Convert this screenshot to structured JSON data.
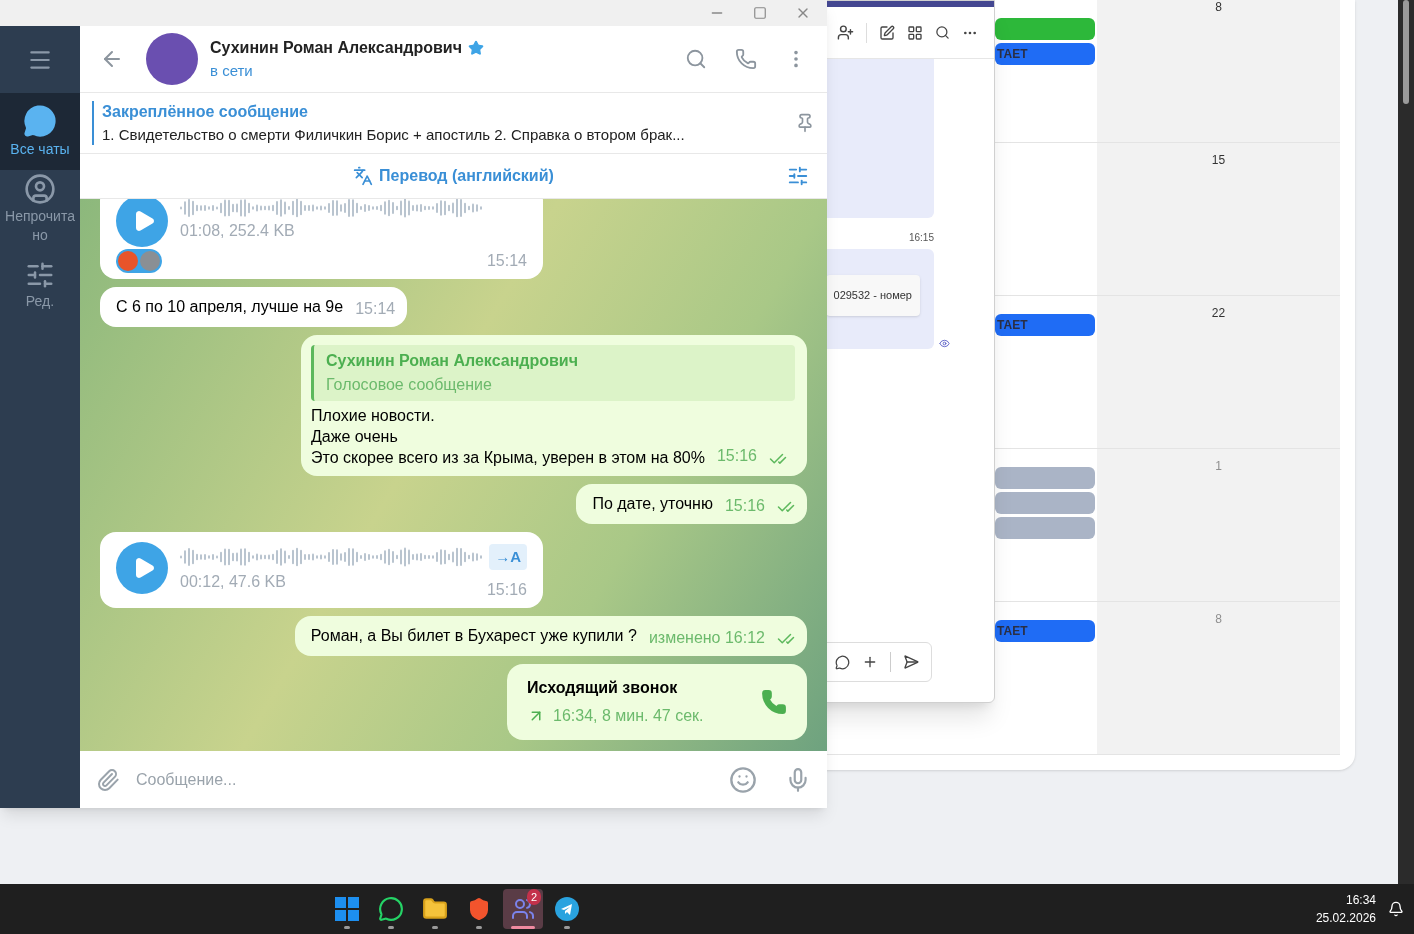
{
  "telegram": {
    "sidebar": {
      "items": [
        {
          "kind": "chats",
          "label": "Все чаты",
          "selected": true
        },
        {
          "kind": "unread",
          "label": "Непрочитано",
          "selected": false
        },
        {
          "kind": "edit",
          "label": "Ред.",
          "selected": false
        }
      ]
    },
    "header": {
      "name": "Сухинин Роман Александрович",
      "starred": true,
      "status": "в сети"
    },
    "pinned": {
      "title": "Закреплённое сообщение",
      "text": "1. Свидетельство о смерти Филичкин Борис + апостиль 2. Справка о втором брак..."
    },
    "translate_bar": {
      "label": "Перевод (английский)"
    },
    "messages": [
      {
        "kind": "voice",
        "out": false,
        "meta": "01:08, 252.4 KB",
        "time": "15:14",
        "reactions": [
          {
            "kind": "emoji"
          },
          {
            "kind": "avatar"
          }
        ]
      },
      {
        "kind": "text",
        "out": false,
        "text": "С 6 по 10 апреля, лучше на 9е",
        "time": "15:14"
      },
      {
        "kind": "reply",
        "out": true,
        "reply_name": "Сухинин Роман Александрович",
        "reply_text": "Голосовое сообщение",
        "lines": [
          "Плохие новости.",
          "Даже очень",
          "Это скорее всего из за Крыма, уверен в этом на 80%"
        ],
        "time": "15:16",
        "read": true
      },
      {
        "kind": "text",
        "out": true,
        "text": "По дате, уточню",
        "time": "15:16",
        "read": true
      },
      {
        "kind": "voice",
        "out": false,
        "meta": "00:12, 47.6 KB",
        "transcribe": "→A",
        "time": "15:16"
      },
      {
        "kind": "text",
        "out": true,
        "text": "Роман, а Вы билет в Бухарест уже купили ?",
        "time": "изменено 16:12",
        "read": true
      },
      {
        "kind": "call",
        "out": true,
        "title": "Исходящий звонок",
        "detail": "16:34, 8 мин. 47 сек."
      }
    ],
    "composer": {
      "placeholder": "Сообщение..."
    }
  },
  "teams": {
    "time": "16:15",
    "card_text": "029532 - номер",
    "seen": true
  },
  "calendar": {
    "rows": [
      {
        "day": "8",
        "muted": false,
        "events": [
          {
            "color": "#2db83a"
          },
          {
            "label": "ТАЕТ",
            "color": "#1f6cf5"
          }
        ]
      },
      {
        "day": "15",
        "muted": false,
        "events": []
      },
      {
        "day": "22",
        "muted": false,
        "events": [
          {
            "label": "ТАЕТ",
            "color": "#1f6cf5"
          }
        ]
      },
      {
        "day": "1",
        "muted": true,
        "events": [
          {
            "color": "#aab4c6"
          },
          {
            "color": "#aab4c6"
          },
          {
            "color": "#aab4c6"
          }
        ]
      },
      {
        "day": "8",
        "muted": true,
        "events": [
          {
            "label": "ТАЕТ",
            "color": "#1f6cf5"
          }
        ]
      }
    ]
  },
  "taskbar": {
    "apps": [
      {
        "kind": "start",
        "selected": false
      },
      {
        "kind": "whatsapp",
        "selected": false
      },
      {
        "kind": "folder",
        "selected": false
      },
      {
        "kind": "brave",
        "selected": false
      },
      {
        "kind": "teams",
        "selected": true,
        "badge": "2"
      },
      {
        "kind": "telegram",
        "selected": false
      }
    ],
    "time": "16:34",
    "date": "25.02.2026"
  }
}
